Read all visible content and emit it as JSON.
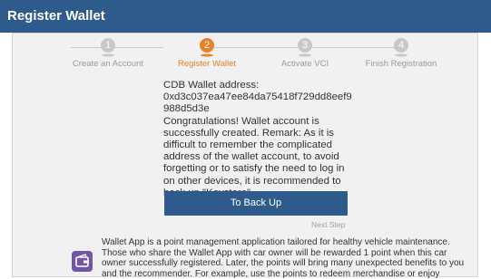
{
  "window": {
    "title": "Register Wallet"
  },
  "steps": [
    {
      "number": "1",
      "label": "Create an Account",
      "state": "done"
    },
    {
      "number": "2",
      "label": "Register Wallet",
      "state": "active"
    },
    {
      "number": "3",
      "label": "Activate VCI",
      "state": "pending"
    },
    {
      "number": "4",
      "label": "Finish Registration",
      "state": "pending"
    }
  ],
  "wallet": {
    "address_label": "CDB Wallet address:",
    "address": "0xd3c037ea47ee84da75418f729dd8eef9988d5d3e",
    "message": "Congratulations! Wallet account is successfully created. Remark: As it is difficult to remember the complicated address of the wallet account, to avoid forgetting or to satisfy the need to log in on other devices, it is recommended to back up \"Keystore\"."
  },
  "actions": {
    "backup_label": "To Back Up",
    "next_label": "Next Step"
  },
  "app_info": {
    "icon": "wallet-app-icon",
    "description": "Wallet App is a point management application tailored for healthy vehicle maintenance. Those who share the Wallet App with car owner will be rewarded 1 point when this car owner successfully registered. Later, the points will bring many unexpected benefits to you and the recommender. For example, use the points to redeem merchandise or enjoy"
  },
  "colors": {
    "header": "#2f5a8c",
    "active_step": "#e8822a",
    "inactive_step": "#c8c8c8",
    "button": "#2f5a8c",
    "app_icon": "#6f56a8"
  }
}
